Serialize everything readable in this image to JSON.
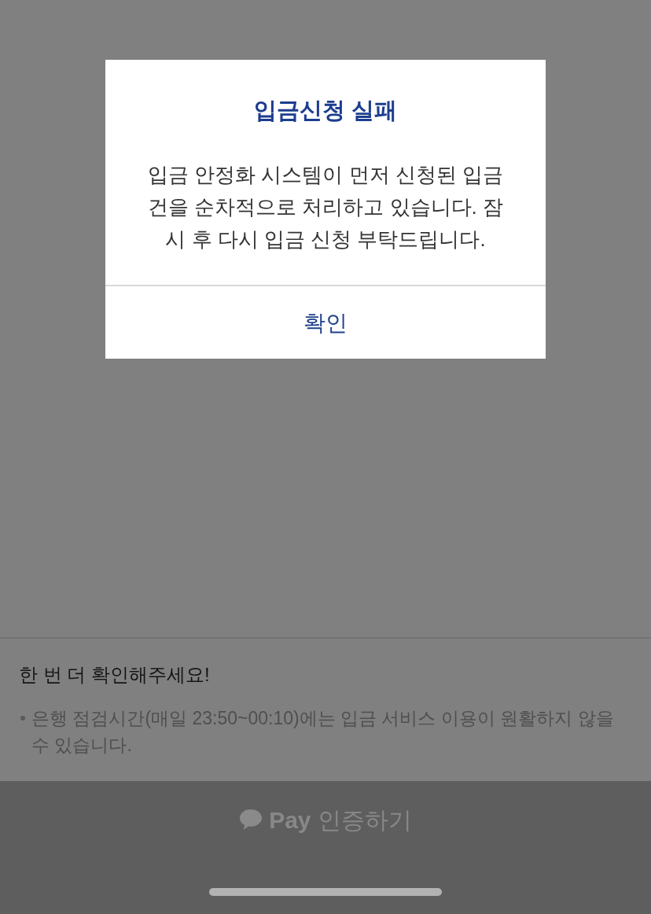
{
  "dialog": {
    "title": "입금신청 실패",
    "message": "입금 안정화 시스템이 먼저 신청된 입금 건을 순차적으로 처리하고 있습니다. 잠시 후 다시 입금 신청 부탁드립니다.",
    "button": "확인"
  },
  "notice": {
    "title": "한 번 더 확인해주세요!",
    "items": [
      "은행 점검시간(매일 23:50~00:10)에는 입금 서비스 이용이 원활하지 않을 수 있습니다."
    ]
  },
  "pay_button": {
    "label": "**Pay** 인증하기"
  }
}
